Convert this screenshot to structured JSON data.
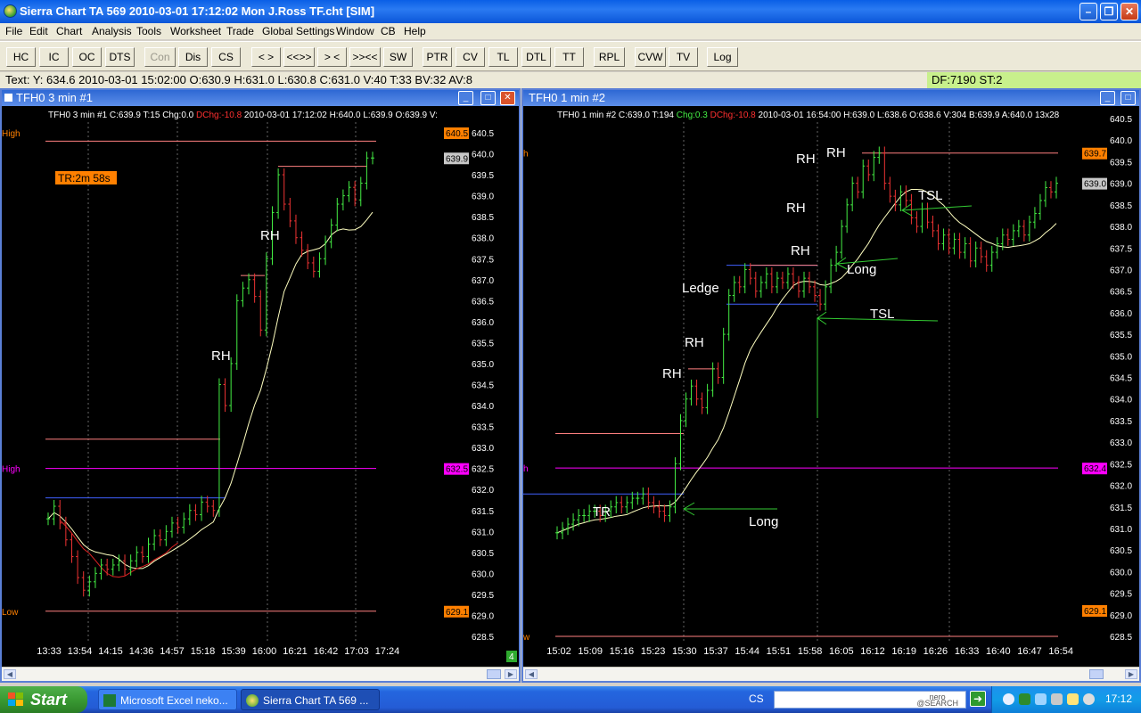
{
  "window": {
    "title": "Sierra Chart TA 569  2010-03-01  17:12:02  Mon   J.Ross TF.cht [SIM]"
  },
  "menu": [
    "File",
    "Edit",
    "Chart",
    "Analysis",
    "Tools",
    "Worksheet",
    "Trade",
    "Global Settings",
    "Window",
    "CB",
    "Help"
  ],
  "toolbar": [
    {
      "label": "HC",
      "enabled": true
    },
    {
      "label": "IC",
      "enabled": true
    },
    {
      "label": "OC",
      "enabled": true
    },
    {
      "label": "DTS",
      "enabled": true
    },
    {
      "label": "Con",
      "enabled": false
    },
    {
      "label": "Dis",
      "enabled": true
    },
    {
      "label": "CS",
      "enabled": true
    },
    {
      "label": "< >",
      "enabled": true
    },
    {
      "label": "<<>>",
      "enabled": true
    },
    {
      "label": "> <",
      "enabled": true
    },
    {
      "label": ">><<",
      "enabled": true
    },
    {
      "label": "SW",
      "enabled": true
    },
    {
      "label": "PTR",
      "enabled": true
    },
    {
      "label": "CV",
      "enabled": true
    },
    {
      "label": "TL",
      "enabled": true
    },
    {
      "label": "DTL",
      "enabled": true
    },
    {
      "label": "TT",
      "enabled": true
    },
    {
      "label": "RPL",
      "enabled": true
    },
    {
      "label": "CVW",
      "enabled": true
    },
    {
      "label": "TV",
      "enabled": true
    },
    {
      "label": "Log",
      "enabled": true
    }
  ],
  "status": {
    "text": "Text: Y: 634.6  2010-03-01  15:02:00  O:630.9  H:631.0  L:630.8  C:631.0  V:40  T:33  BV:32  AV:8",
    "df": "DF:7190   ST:2"
  },
  "chart1": {
    "window_title": "TFH0  3 min  #1",
    "header_prefix": "TFH0  3 min   #1 C:639.9 T:15 Chg:0.0 ",
    "header_dchg": "DChg:-10.8",
    "header_suffix": " 2010-03-01 17:12:02 H:640.0 L:639.9 O:639.9 V:",
    "timer": "TR:2m 58s",
    "high_label_top": "High",
    "high_label_mid": "High",
    "low_label": "Low",
    "scroll_badge": "4",
    "price_badges": [
      {
        "value": "640.5",
        "color": "#ff8000"
      },
      {
        "value": "639.9",
        "color": "#c8c8c8"
      },
      {
        "value": "632.5",
        "color": "#ff00ff"
      },
      {
        "value": "629.1",
        "color": "#ff8000"
      }
    ],
    "annotations": [
      {
        "text": "RH"
      },
      {
        "text": "RH"
      }
    ],
    "chart_data": {
      "type": "ohlc",
      "y_range": [
        628.5,
        640.5
      ],
      "y_ticks": [
        "640.5",
        "640.0",
        "639.5",
        "639.0",
        "638.5",
        "638.0",
        "637.5",
        "637.0",
        "636.5",
        "636.0",
        "635.5",
        "635.0",
        "634.5",
        "634.0",
        "633.5",
        "633.0",
        "632.5",
        "632.0",
        "631.5",
        "631.0",
        "630.5",
        "630.0",
        "629.5",
        "629.0",
        "628.5"
      ],
      "x_ticks": [
        "13:33",
        "13:54",
        "14:15",
        "14:36",
        "14:57",
        "15:18",
        "15:39",
        "16:00",
        "16:21",
        "16:42",
        "17:03",
        "17:24"
      ],
      "closes": [
        631.3,
        631.6,
        631.2,
        630.8,
        630.4,
        629.9,
        629.6,
        629.8,
        630.0,
        630.2,
        630.1,
        630.2,
        630.3,
        630.1,
        630.3,
        630.5,
        630.4,
        630.7,
        630.9,
        630.8,
        631.0,
        631.2,
        631.1,
        631.3,
        631.5,
        631.4,
        631.7,
        631.6,
        631.5,
        634.5,
        634.0,
        635.0,
        636.5,
        636.8,
        637.0,
        636.6,
        635.8,
        637.5,
        638.6,
        639.5,
        638.8,
        638.4,
        638.0,
        637.7,
        637.4,
        637.2,
        637.5,
        637.9,
        638.3,
        638.8,
        639.0,
        639.2,
        638.9,
        639.3,
        639.9,
        639.9
      ]
    }
  },
  "chart2": {
    "window_title": "TFH0  1 min   #2",
    "header_prefix": "TFH0  1 min   #2 C:639.0 T:194 ",
    "header_chg": "Chg:0.3",
    "header_dchg": "DChg:-10.8",
    "header_suffix": " 2010-03-01 16:54:00 H:639.0 L:638.6 O:638.6 V:304 B:639.9 A:640.0 13x28",
    "high_label": "h",
    "mid_label": "h",
    "low_label": "w",
    "price_badges": [
      {
        "value": "639.7",
        "color": "#ff8000"
      },
      {
        "value": "639.0",
        "color": "#c8c8c8"
      },
      {
        "value": "632.4",
        "color": "#ff00ff"
      },
      {
        "value": "629.1",
        "color": "#ff8000"
      }
    ],
    "annotations": [
      {
        "text": "TR"
      },
      {
        "text": "Long"
      },
      {
        "text": "RH"
      },
      {
        "text": "RH"
      },
      {
        "text": "Ledge"
      },
      {
        "text": "RH"
      },
      {
        "text": "RH"
      },
      {
        "text": "RH"
      },
      {
        "text": "RH"
      },
      {
        "text": "Long"
      },
      {
        "text": "TSL"
      },
      {
        "text": "TSL"
      }
    ],
    "chart_data": {
      "type": "ohlc",
      "y_range": [
        628.5,
        640.5
      ],
      "y_ticks": [
        "640.5",
        "640.0",
        "639.5",
        "639.0",
        "638.5",
        "638.0",
        "637.5",
        "637.0",
        "636.5",
        "636.0",
        "635.5",
        "635.0",
        "634.5",
        "634.0",
        "633.5",
        "633.0",
        "632.5",
        "632.0",
        "631.5",
        "631.0",
        "630.5",
        "630.0",
        "629.5",
        "629.0",
        "628.5"
      ],
      "x_ticks": [
        "15:02",
        "15:09",
        "15:16",
        "15:23",
        "15:30",
        "15:37",
        "15:44",
        "15:51",
        "15:58",
        "16:05",
        "16:12",
        "16:19",
        "16:26",
        "16:33",
        "16:40",
        "16:47",
        "16:54"
      ],
      "closes": [
        630.9,
        631.0,
        631.1,
        631.2,
        631.3,
        631.3,
        631.4,
        631.4,
        631.3,
        631.4,
        631.5,
        631.6,
        631.5,
        631.6,
        631.7,
        631.7,
        631.8,
        631.6,
        631.5,
        631.4,
        631.3,
        631.5,
        632.5,
        633.5,
        634.0,
        634.3,
        634.0,
        633.8,
        634.2,
        634.7,
        634.5,
        635.5,
        636.4,
        636.7,
        636.6,
        637.0,
        636.8,
        636.5,
        636.7,
        636.9,
        636.6,
        636.8,
        636.7,
        636.9,
        636.7,
        636.5,
        636.8,
        636.6,
        636.4,
        636.2,
        636.6,
        637.1,
        637.4,
        638.0,
        638.5,
        639.0,
        638.8,
        639.4,
        639.2,
        639.6,
        639.7,
        639.0,
        638.7,
        638.5,
        638.8,
        638.6,
        638.2,
        638.0,
        638.4,
        638.1,
        637.9,
        637.6,
        637.8,
        637.5,
        637.7,
        637.4,
        637.6,
        637.2,
        637.5,
        637.3,
        637.1,
        637.4,
        637.6,
        637.8,
        637.7,
        637.9,
        638.0,
        637.8,
        638.1,
        638.3,
        638.6,
        638.9,
        638.8,
        639.0
      ]
    }
  },
  "taskbar": {
    "start": "Start",
    "items": [
      {
        "label": "Microsoft Excel neko..."
      },
      {
        "label": "Sierra Chart TA 569  ..."
      }
    ],
    "cs": "CS",
    "search_brand_top": "nero",
    "search_brand_bottom": "@SEARCH",
    "clock": "17:12"
  }
}
